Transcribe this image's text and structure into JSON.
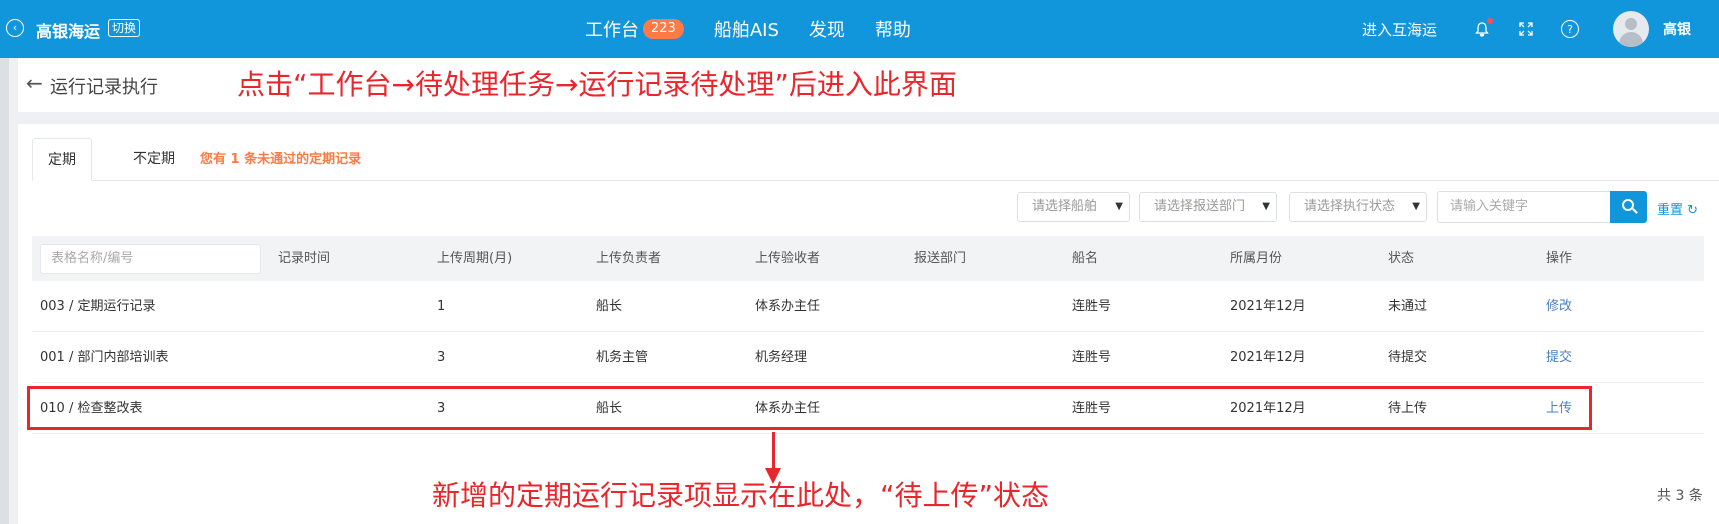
{
  "topbar": {
    "brand": "高银海运",
    "switch_label": "切换",
    "nav": [
      {
        "label": "工作台",
        "badge": "223"
      },
      {
        "label": "船舶AIS"
      },
      {
        "label": "发现"
      },
      {
        "label": "帮助"
      }
    ],
    "enter_link": "进入互海运",
    "username": "高银",
    "icons": [
      "bell-icon",
      "fullscreen-icon",
      "help-icon"
    ]
  },
  "page": {
    "title": "运行记录执行",
    "annotation_top": "点击“工作台→待处理任务→运行记录待处理”后进入此界面",
    "annotation_bottom": "新增的定期运行记录项显示在此处，“待上传”状态"
  },
  "tabs": {
    "items": [
      "定期",
      "不定期"
    ],
    "active": "定期",
    "note": "您有 1 条未通过的定期记录"
  },
  "filters": {
    "ship_placeholder": "请选择船舶",
    "dept_placeholder": "请选择报送部门",
    "status_placeholder": "请选择执行状态",
    "keyword_placeholder": "请输入关键字",
    "reset_label": "重置"
  },
  "table": {
    "name_filter_placeholder": "表格名称/编号",
    "columns": [
      "记录时间",
      "上传周期(月)",
      "上传负责者",
      "上传验收者",
      "报送部门",
      "船名",
      "所属月份",
      "状态",
      "操作"
    ],
    "rows": [
      {
        "name": "003 / 定期运行记录",
        "record_time": "",
        "cycle": "1",
        "uploader": "船长",
        "reviewer": "体系办主任",
        "dept": "",
        "ship": "连胜号",
        "month": "2021年12月",
        "status": "未通过",
        "action": "修改"
      },
      {
        "name": "001 / 部门内部培训表",
        "record_time": "",
        "cycle": "3",
        "uploader": "机务主管",
        "reviewer": "机务经理",
        "dept": "",
        "ship": "连胜号",
        "month": "2021年12月",
        "status": "待提交",
        "action": "提交"
      },
      {
        "name": "010 / 检查整改表",
        "record_time": "",
        "cycle": "3",
        "uploader": "船长",
        "reviewer": "体系办主任",
        "dept": "",
        "ship": "连胜号",
        "month": "2021年12月",
        "status": "待上传",
        "action": "上传"
      }
    ],
    "total": "共 3 条"
  },
  "colors": {
    "topbar": "#1296db",
    "annotation": "#e8262b",
    "note": "#ff7a45",
    "link": "#4a7fc1"
  }
}
